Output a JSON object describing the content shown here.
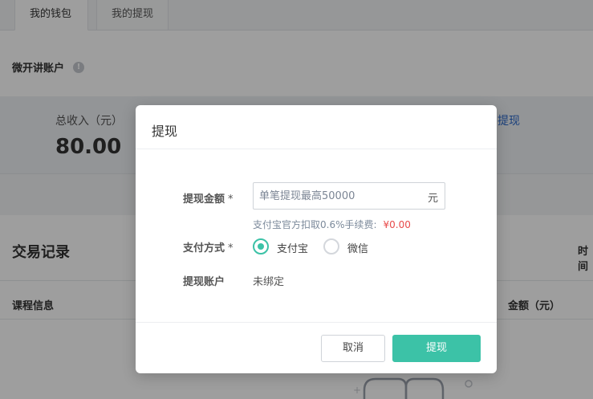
{
  "tabs": [
    {
      "label": "我的钱包",
      "active": true
    },
    {
      "label": "我的提现",
      "active": false
    }
  ],
  "account": {
    "title": "微开讲账户",
    "info_icon": "!"
  },
  "stats": {
    "total_income_label": "总收入（元）",
    "total_income_value": "80.00",
    "withdraw_link": "提现"
  },
  "records": {
    "title": "交易记录",
    "time_label": "时间",
    "columns": [
      "课程信息",
      "金额（元）"
    ]
  },
  "modal": {
    "title": "提现",
    "amount_label": "提现金额",
    "required_mark": "*",
    "amount_placeholder": "单笔提现最高50000",
    "amount_value": "",
    "amount_unit": "元",
    "fee_note": "支付宝官方扣取0.6%手续费:",
    "fee_amount": "¥0.00",
    "pay_method_label": "支付方式",
    "pay_options": [
      {
        "label": "支付宝",
        "selected": true
      },
      {
        "label": "微信",
        "selected": false
      }
    ],
    "account_label": "提现账户",
    "account_value": "未绑定",
    "cancel_label": "取消",
    "submit_label": "提现"
  },
  "colors": {
    "accent": "#3cc2a7",
    "link": "#2b68c9",
    "fee": "#e84a4a"
  }
}
